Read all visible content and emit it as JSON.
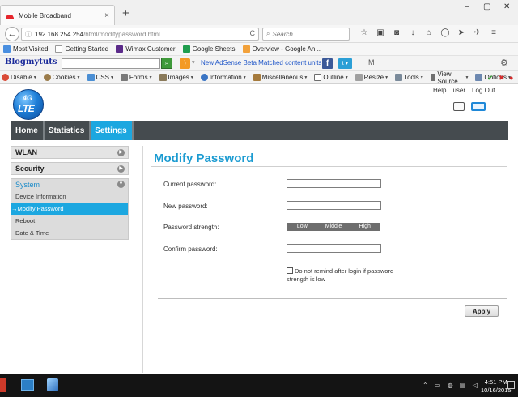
{
  "browser": {
    "tab_title": "Mobile Broadband",
    "tab_close": "×",
    "new_tab": "+",
    "window_controls": [
      "–",
      "▢",
      "✕"
    ],
    "back_glyph": "←",
    "url_host": "192.168.254.254",
    "url_path": "/html/modifypassword.html",
    "url_info": "ⓘ",
    "reload_glyph": "C",
    "search_placeholder": "Search",
    "toolbar_icons": [
      "star-icon",
      "clipboard-icon",
      "pocket-icon",
      "download-icon",
      "home-icon",
      "chat-icon",
      "send-icon",
      "plane-icon",
      "menu-icon"
    ],
    "toolbar_glyphs": [
      "☆",
      "▣",
      "◙",
      "↓",
      "⌂",
      "◯",
      "➤",
      "✈",
      "≡"
    ]
  },
  "bookmarks": [
    {
      "label": "Most Visited",
      "color": "#4a8fe0"
    },
    {
      "label": "Getting Started",
      "color": "#ffffff"
    },
    {
      "label": "Wimax Customer",
      "color": "#5b2b8a"
    },
    {
      "label": "Google Sheets",
      "color": "#1f9d4e"
    },
    {
      "label": "Overview - Google An...",
      "color": "#f2a13a"
    }
  ],
  "toolbar2": {
    "logo": "Blogmytuts",
    "search_glyph": "⌕",
    "rss_glyph": ")",
    "drop_glyph": "▾",
    "ad_link": "New AdSense Beta Matched content units",
    "fb_glyph": "f",
    "tw_glyph": "t ▾",
    "mail_glyph": "M",
    "gear_glyph": "⚙"
  },
  "devtools": {
    "items": [
      "Disable",
      "Cookies",
      "CSS",
      "Forms",
      "Images",
      "Information",
      "Miscellaneous",
      "Outline",
      "Resize",
      "Tools",
      "View Source",
      "Options"
    ],
    "colors": [
      "#d94a36",
      "#9a7b4a",
      "#4b8fd4",
      "#7a7a7a",
      "#8a7a5a",
      "#3a74c4",
      "#a57a3c",
      "#6d6d6d",
      "#a0a0a0",
      "#7a8a9a",
      "#6f6f6f",
      "#6d88b0"
    ],
    "status_ok": "✔",
    "status_err": "✖",
    "status_info": "●",
    "ok_color": "#2e9a2e",
    "err_color": "#d42b2b",
    "info_color": "#d42b2b"
  },
  "router": {
    "logo_top": "4G",
    "logo_bottom": "LTE",
    "top_links": [
      "Help",
      "user",
      "Log Out"
    ],
    "menu": [
      {
        "label": "Home",
        "active": false
      },
      {
        "label": "Statistics",
        "active": false
      },
      {
        "label": "Settings",
        "active": true
      }
    ],
    "sidebar": {
      "sections": [
        "WLAN",
        "Security"
      ],
      "group_title": "System",
      "items": [
        {
          "label": "Device Information",
          "active": false
        },
        {
          "label": "→Modify Password",
          "active": true
        },
        {
          "label": "Reboot",
          "active": false
        },
        {
          "label": "Date & Time",
          "active": false
        }
      ],
      "arrow_right": "▶",
      "arrow_down": "▼"
    },
    "content": {
      "title": "Modify Password",
      "current_password_label": "Current password:",
      "new_password_label": "New password:",
      "strength_label": "Password strength:",
      "strength_levels": [
        "Low",
        "Middle",
        "High"
      ],
      "confirm_password_label": "Confirm password:",
      "current_password_value": "",
      "new_password_value": "",
      "confirm_password_value": "",
      "remind_text": "Do not remind after login if password strength is low",
      "remind_checked": false,
      "apply_label": "Apply"
    },
    "accent_color": "#1ca7e0",
    "menu_bg": "#454b4f"
  },
  "taskbar": {
    "time": "4:51 PM",
    "date": "10/16/2015",
    "tray": "⌃ ▭ ◍ ▤ ◁"
  }
}
